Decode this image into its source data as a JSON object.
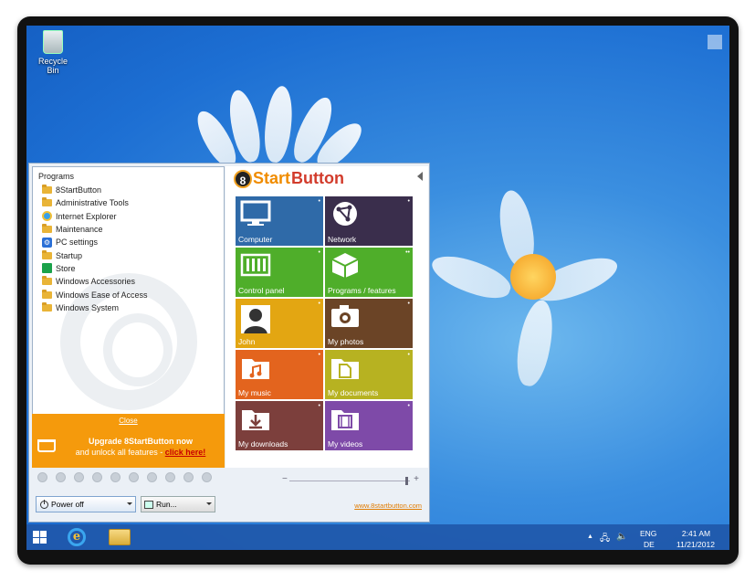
{
  "desktop": {
    "recycle_bin_label": "Recycle Bin"
  },
  "start_menu": {
    "programs_title": "Programs",
    "programs": [
      {
        "label": "8StartButton",
        "icon": "folder-icon"
      },
      {
        "label": "Administrative Tools",
        "icon": "folder-icon"
      },
      {
        "label": "Internet Explorer",
        "icon": "internet-explorer-icon"
      },
      {
        "label": "Maintenance",
        "icon": "folder-icon"
      },
      {
        "label": "PC settings",
        "icon": "gear-icon"
      },
      {
        "label": "Startup",
        "icon": "folder-icon"
      },
      {
        "label": "Store",
        "icon": "store-icon"
      },
      {
        "label": "Windows Accessories",
        "icon": "folder-icon"
      },
      {
        "label": "Windows Ease of Access",
        "icon": "folder-icon"
      },
      {
        "label": "Windows System",
        "icon": "folder-icon"
      }
    ],
    "close_label": "Close",
    "upgrade": {
      "line1": "Upgrade 8StartButton now",
      "line2_prefix": "and unlock all features - ",
      "link": "click here!"
    },
    "logo": {
      "part1": "8",
      "part2": "Start",
      "part3": "Button"
    },
    "tiles": [
      {
        "label": "Computer",
        "color": "#2f6aa8",
        "icon": "monitor-icon",
        "mark": "•"
      },
      {
        "label": "Network",
        "color": "#3a2e4c",
        "icon": "network-icon",
        "mark": "•"
      },
      {
        "label": "Control panel",
        "color": "#4fae2a",
        "icon": "control-panel-icon",
        "mark": "•"
      },
      {
        "label": "Programs / features",
        "color": "#4fae2a",
        "icon": "box-icon",
        "mark": "••"
      },
      {
        "label": "John",
        "color": "#e3a612",
        "icon": "user-icon",
        "mark": "•"
      },
      {
        "label": "My photos",
        "color": "#6b4426",
        "icon": "camera-icon",
        "mark": "•"
      },
      {
        "label": "My music",
        "color": "#e3641e",
        "icon": "music-folder-icon",
        "mark": "•"
      },
      {
        "label": "My documents",
        "color": "#b7b221",
        "icon": "document-folder-icon",
        "mark": "•"
      },
      {
        "label": "My downloads",
        "color": "#7c3f3c",
        "icon": "download-folder-icon",
        "mark": "•"
      },
      {
        "label": "My videos",
        "color": "#7e4aa8",
        "icon": "video-folder-icon",
        "mark": "•"
      }
    ],
    "zoom_minus": "−",
    "zoom_plus": "+",
    "power_label": "Power off",
    "run_label": "Run...",
    "website": "www.8startbutton.com"
  },
  "taskbar": {
    "lang_top": "ENG",
    "lang_bottom": "DE",
    "time": "2:41 AM",
    "date": "11/21/2012"
  }
}
